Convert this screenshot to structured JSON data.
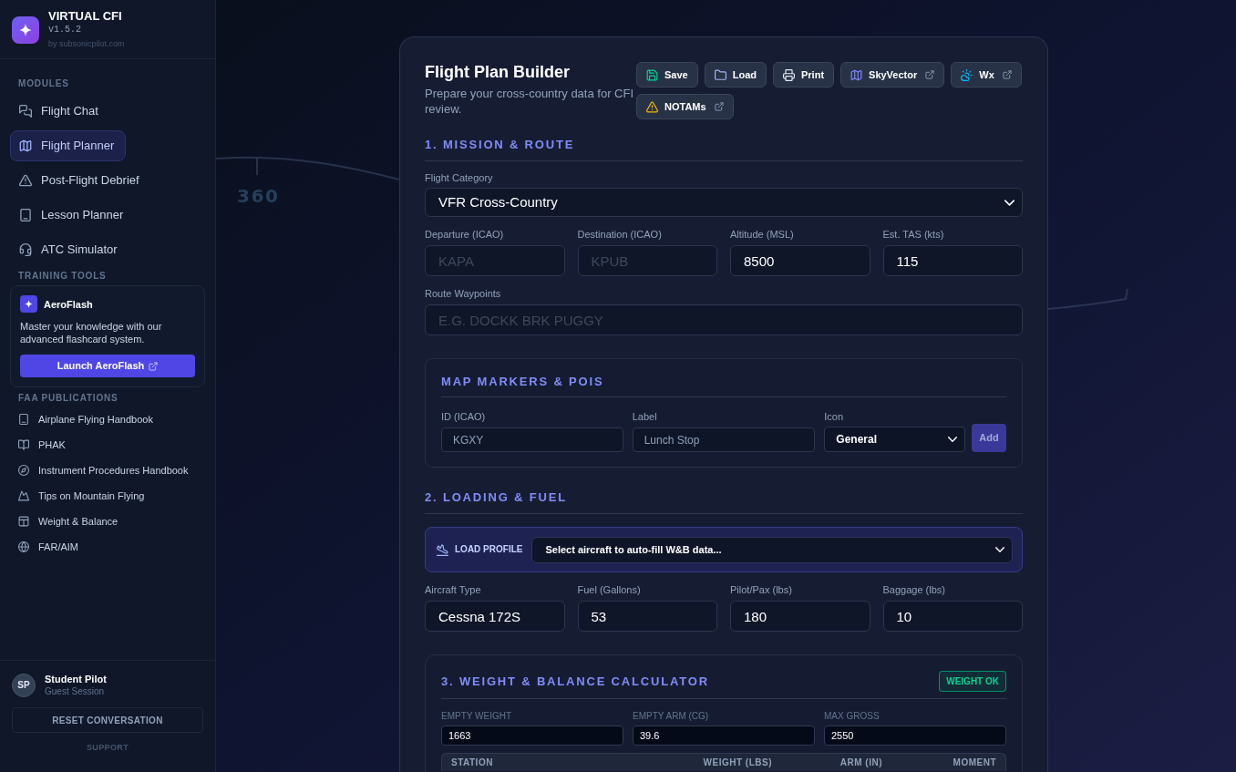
{
  "background": {
    "compass_label": "360"
  },
  "sidebar": {
    "brand": {
      "title": "VIRTUAL CFI",
      "version": "v1.5.2",
      "byline": "by subsonicpilot.com"
    },
    "modules": {
      "heading": "MODULES",
      "items": [
        {
          "label": "Flight Chat",
          "selected": false
        },
        {
          "label": "Flight Planner",
          "selected": true
        },
        {
          "label": "Post-Flight Debrief",
          "selected": false
        },
        {
          "label": "Lesson Planner",
          "selected": false
        },
        {
          "label": "ATC Simulator",
          "selected": false
        }
      ]
    },
    "training_tools": {
      "heading": "TRAINING TOOLS",
      "card": {
        "title": "AeroFlash",
        "description": "Master your knowledge with our advanced flashcard system.",
        "button": "Launch AeroFlash"
      }
    },
    "publications": {
      "heading": "FAA PUBLICATIONS",
      "items": [
        "Airplane Flying Handbook",
        "PHAK",
        "Instrument Procedures Handbook",
        "Tips on Mountain Flying",
        "Weight & Balance",
        "FAR/AIM"
      ]
    },
    "user": {
      "initials": "SP",
      "name": "Student Pilot",
      "session": "Guest Session"
    },
    "reset_button": "RESET CONVERSATION",
    "support_link": "SUPPORT"
  },
  "flight_plan": {
    "title": "Flight Plan Builder",
    "subtitle": "Prepare your cross-country data for CFI review.",
    "toolbar": [
      {
        "label": "Save",
        "external": false
      },
      {
        "label": "Load",
        "external": false
      },
      {
        "label": "Print",
        "external": false
      },
      {
        "label": "SkyVector",
        "external": true
      },
      {
        "label": "Wx",
        "external": true
      },
      {
        "label": "NOTAMs",
        "external": true
      }
    ],
    "mission": {
      "heading": "1. MISSION & ROUTE",
      "category": {
        "label": "Flight Category",
        "value": "VFR Cross-Country"
      },
      "fields": [
        {
          "label": "Departure (ICAO)",
          "placeholder": "KAPA"
        },
        {
          "label": "Destination (ICAO)",
          "placeholder": "KPUB"
        },
        {
          "label": "Altitude (MSL)",
          "value": "8500"
        },
        {
          "label": "Est. TAS (kts)",
          "value": "115"
        }
      ],
      "waypoints": {
        "label": "Route Waypoints",
        "placeholder": "E.G. DOCKK BRK PUGGY"
      }
    },
    "markers": {
      "heading": "MAP MARKERS & POIS",
      "id_field": {
        "label": "ID (ICAO)",
        "placeholder": "KGXY"
      },
      "label_field": {
        "label": "Label",
        "placeholder": "Lunch Stop"
      },
      "icon_select": {
        "label": "Icon",
        "value": "General"
      },
      "add_button": {
        "label": "Add",
        "disabled": true
      }
    },
    "loading": {
      "heading": "2. LOADING & FUEL",
      "profile": {
        "label": "LOAD PROFILE",
        "value": "Select aircraft to auto-fill W&B data..."
      },
      "fields": [
        {
          "label": "Aircraft Type",
          "value": "Cessna 172S"
        },
        {
          "label": "Fuel (Gallons)",
          "value": "53"
        },
        {
          "label": "Pilot/Pax (lbs)",
          "value": "180"
        },
        {
          "label": "Baggage (lbs)",
          "value": "10"
        }
      ]
    },
    "weight_balance": {
      "heading": "3. WEIGHT & BALANCE CALCULATOR",
      "status": {
        "label": "WEIGHT OK",
        "ok": true
      },
      "fields": [
        {
          "label": "EMPTY WEIGHT",
          "value": "1663"
        },
        {
          "label": "EMPTY ARM (CG)",
          "value": "39.6"
        },
        {
          "label": "MAX GROSS",
          "value": "2550"
        }
      ],
      "table": {
        "columns": [
          "STATION",
          "WEIGHT (LBS)",
          "ARM (IN)",
          "MOMENT"
        ]
      }
    }
  }
}
